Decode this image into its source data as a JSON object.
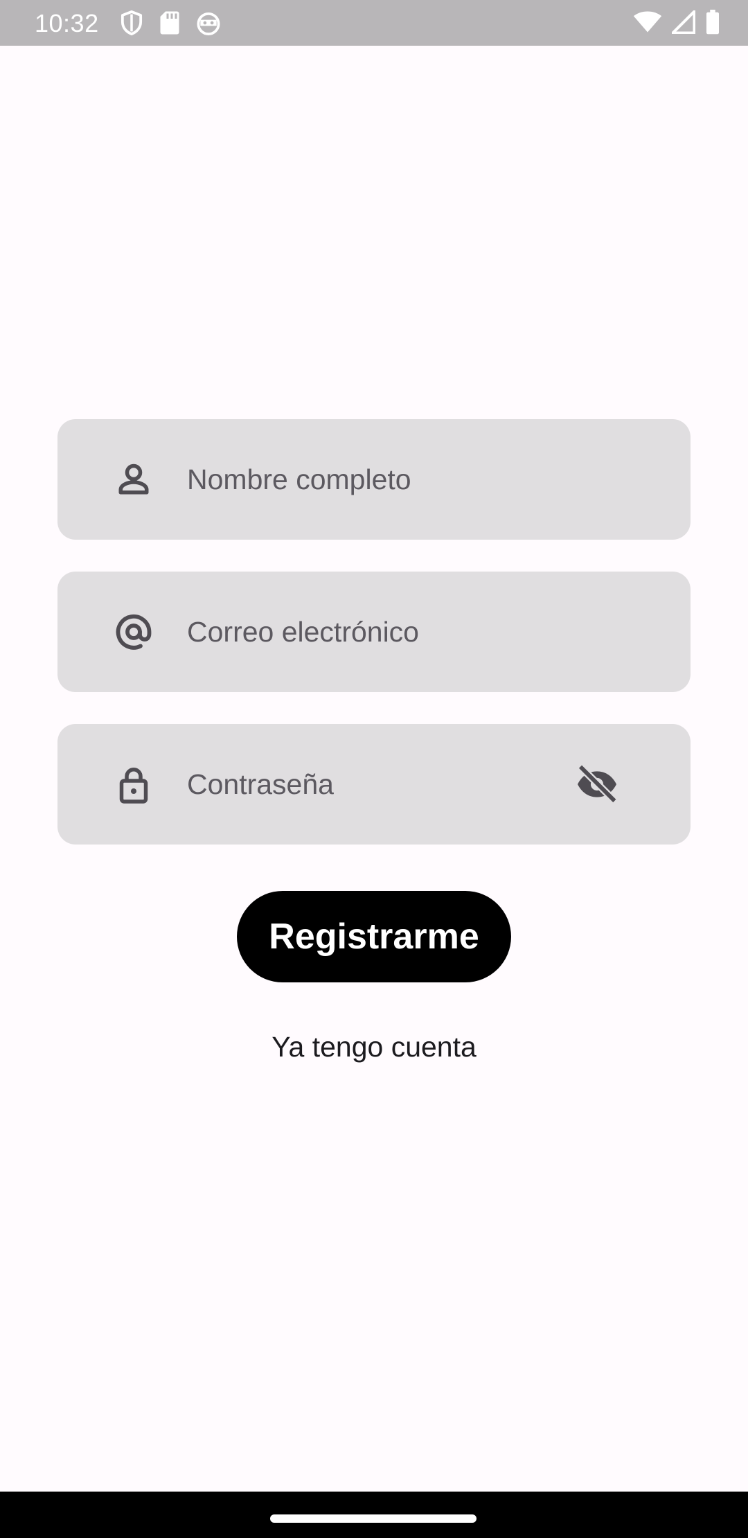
{
  "status_bar": {
    "time": "10:32",
    "left_icons": [
      "shield-icon",
      "sd-card-icon",
      "robot-face-icon"
    ],
    "right_icons": [
      "wifi-icon",
      "cell-signal-icon",
      "battery-icon"
    ]
  },
  "form": {
    "name_field": {
      "placeholder": "Nombre completo",
      "value": "",
      "icon": "person-icon"
    },
    "email_field": {
      "placeholder": "Correo electrónico",
      "value": "",
      "icon": "at-sign-icon"
    },
    "password_field": {
      "placeholder": "Contraseña",
      "value": "",
      "icon": "lock-icon",
      "toggle_icon": "eye-off-icon"
    },
    "submit_label": "Registrarme",
    "login_link": "Ya tengo cuenta"
  },
  "colors": {
    "background": "#fffbfe",
    "field_background": "#e0dee0",
    "button_background": "#000000",
    "button_text": "#ffffff",
    "status_bar": "#b8b6b8"
  }
}
